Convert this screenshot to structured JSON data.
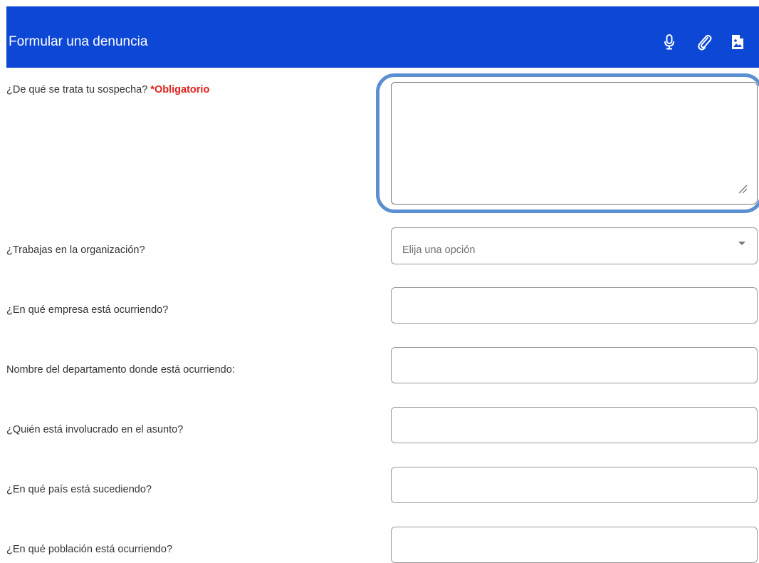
{
  "header": {
    "title": "Formular una denuncia",
    "icons": [
      "microphone-icon",
      "paperclip-icon",
      "image-file-icon"
    ],
    "background": "#0d47d6"
  },
  "form": {
    "suspicion_label": "¿De qué se trata tu sospecha?",
    "required_marker": "*Obligatorio",
    "suspicion_value": "",
    "employee_label": "¿Trabajas en la organización?",
    "employee_placeholder": "Elija una opción",
    "company_label": "¿En qué empresa está ocurriendo?",
    "company_value": "",
    "department_label": "Nombre del departamento donde está ocurriendo:",
    "department_value": "",
    "involved_label": "¿Quién está involucrado en el asunto?",
    "involved_value": "",
    "country_label": "¿En qué país está sucediendo?",
    "country_value": "",
    "town_label": "¿En qué población está ocurriendo?",
    "town_value": ""
  },
  "colors": {
    "required": "#e0201b",
    "focus_ring": "#5b8fd0"
  }
}
